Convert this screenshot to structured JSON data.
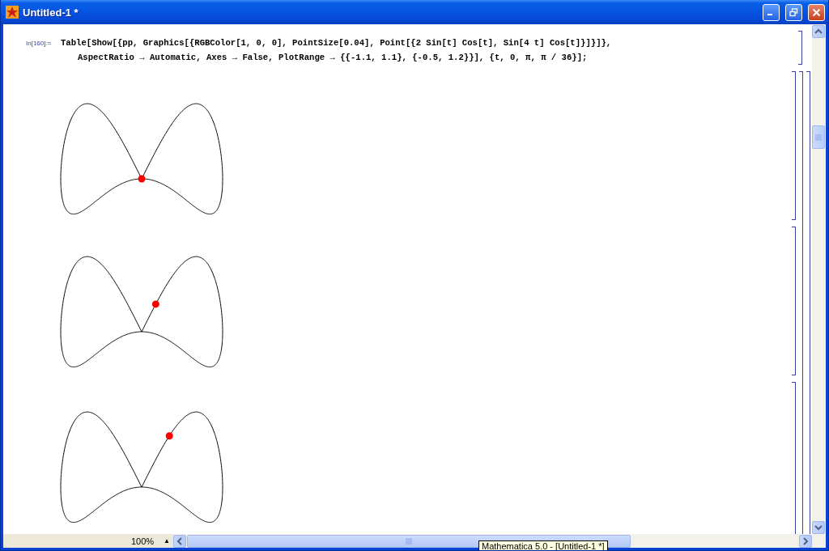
{
  "window": {
    "title": "Untitled-1 *"
  },
  "input_cell": {
    "label": "In[160]:=",
    "lines": [
      "Table[Show[{pp, Graphics[{RGBColor[1, 0, 0], PointSize[0.04], Point[{2 Sin[t] Cos[t], Sin[4 t] Cos[t]}]}]},",
      "AspectRatio → Automatic, Axes → False, PlotRange → {{-1.1, 1.1}, {-0.5, 1.2}}], {t, 0, π, π / 36}];"
    ]
  },
  "status_bar": {
    "zoom": "100%",
    "zoom_arrow": "▲"
  },
  "tooltip": "Mathematica 5.0 - [Untitled-1 *]"
}
